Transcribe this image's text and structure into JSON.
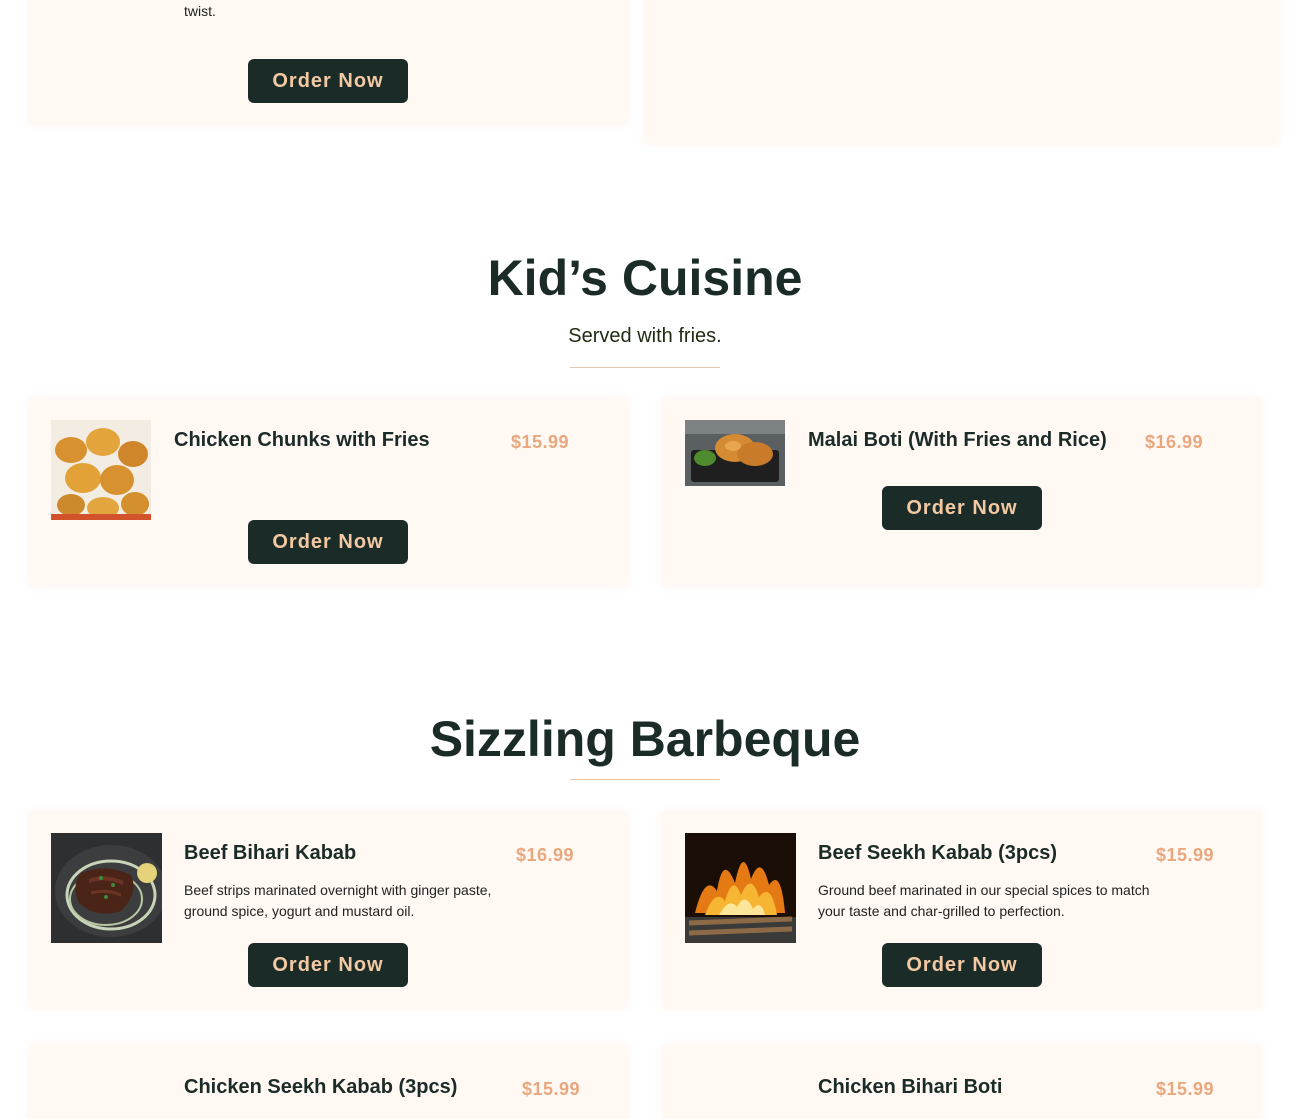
{
  "top_card": {
    "desc_tail": "twist.",
    "order_label": "Order Now"
  },
  "kids": {
    "title": "Kid’s Cuisine",
    "subtitle": "Served with fries.",
    "items": [
      {
        "name": "Chicken Chunks with Fries",
        "price": "$15.99",
        "order_label": "Order Now",
        "image": "chicken-chunks-photo"
      },
      {
        "name": "Malai Boti (With Fries and Rice)",
        "price": "$16.99",
        "order_label": "Order Now",
        "image": "malai-boti-photo"
      }
    ]
  },
  "bbq": {
    "title": "Sizzling Barbeque",
    "items": [
      {
        "name": "Beef Bihari Kabab",
        "price": "$16.99",
        "desc_line1": "Beef strips marinated overnight with ginger paste,",
        "desc_line2": "ground spice, yogurt and mustard oil.",
        "order_label": "Order Now",
        "image": "beef-bihari-photo"
      },
      {
        "name": "Beef Seekh Kabab (3pcs)",
        "price": "$15.99",
        "desc_line1": "Ground beef marinated in our special spices to match",
        "desc_line2": "your taste and char-grilled to perfection.",
        "order_label": "Order Now",
        "image": "beef-seekh-photo"
      },
      {
        "name": "Chicken Seekh Kabab (3pcs)",
        "price": "$15.99"
      },
      {
        "name": "Chicken Bihari Boti",
        "price": "$15.99"
      }
    ]
  },
  "colors": {
    "accent_dark": "#1b2b27",
    "price": "#e9a77d",
    "card_bg": "#fff8f3",
    "button_text": "#f3c9a4"
  }
}
